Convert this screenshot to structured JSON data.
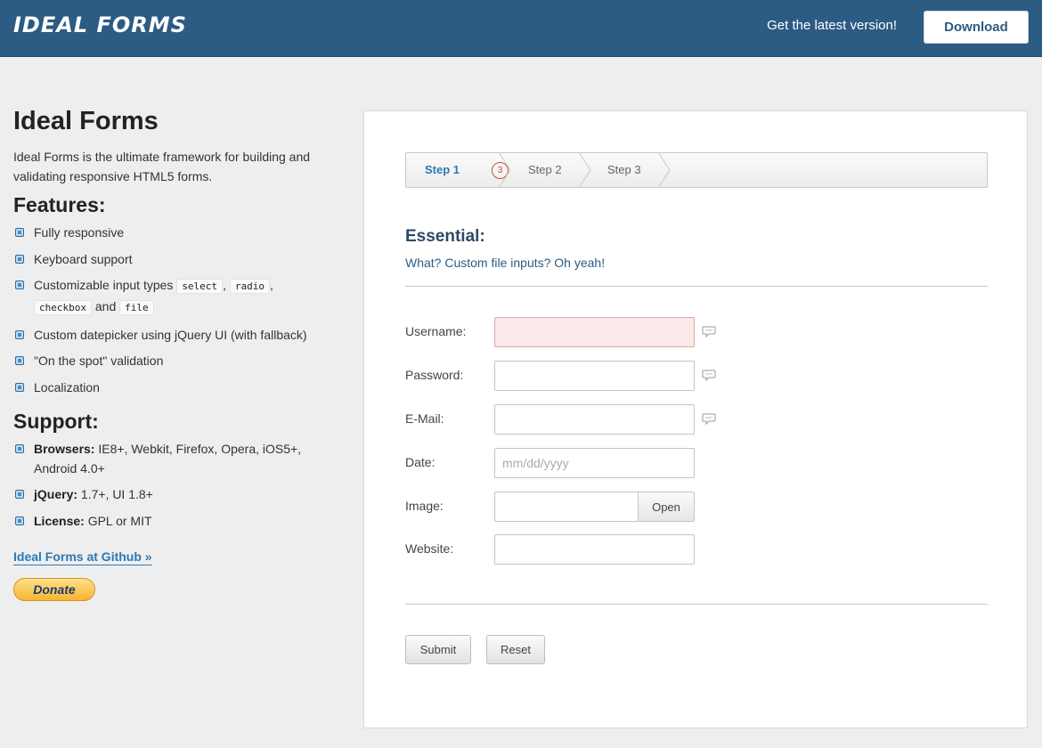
{
  "header": {
    "logo": "IDEAL FORMS",
    "tagline": "Get the latest version!",
    "download_label": "Download"
  },
  "sidebar": {
    "title": "Ideal Forms",
    "description": "Ideal Forms is the ultimate framework for building and validating responsive HTML5 forms.",
    "features_heading": "Features:",
    "features": {
      "item1": "Fully responsive",
      "item2": "Keyboard support",
      "item3_prefix": "Customizable input types",
      "item3_code1": "select",
      "item3_code2": "radio",
      "item3_code3": "checkbox",
      "item3_and": "and",
      "item3_code4": "file",
      "item4": "Custom datepicker using jQuery UI (with fallback)",
      "item5": "\"On the spot\" validation",
      "item6": "Localization"
    },
    "support_heading": "Support:",
    "support": {
      "browsers_label": "Browsers:",
      "browsers_value": "IE8+, Webkit, Firefox, Opera, iOS5+, Android 4.0+",
      "jquery_label": "jQuery:",
      "jquery_value": "1.7+, UI 1.8+",
      "license_label": "License:",
      "license_value": "GPL or MIT"
    },
    "github_link": "Ideal Forms at Github »",
    "donate_label": "Donate"
  },
  "steps": {
    "step1": "Step 1",
    "step1_badge": "3",
    "step2": "Step 2",
    "step3": "Step 3"
  },
  "form": {
    "section_title": "Essential:",
    "section_subtitle": "What? Custom file inputs? Oh yeah!",
    "username_label": "Username:",
    "password_label": "Password:",
    "email_label": "E-Mail:",
    "date_label": "Date:",
    "date_placeholder": "mm/dd/yyyy",
    "image_label": "Image:",
    "image_button": "Open",
    "website_label": "Website:",
    "submit_label": "Submit",
    "reset_label": "Reset"
  },
  "colors": {
    "header_bg": "#2c5b84",
    "accent": "#2c79b5",
    "invalid_bg": "#fbe8e8",
    "badge": "#c0533b"
  },
  "icons": {
    "bullet": "bullet-icon",
    "field_info": "speech-bubble-icon"
  }
}
